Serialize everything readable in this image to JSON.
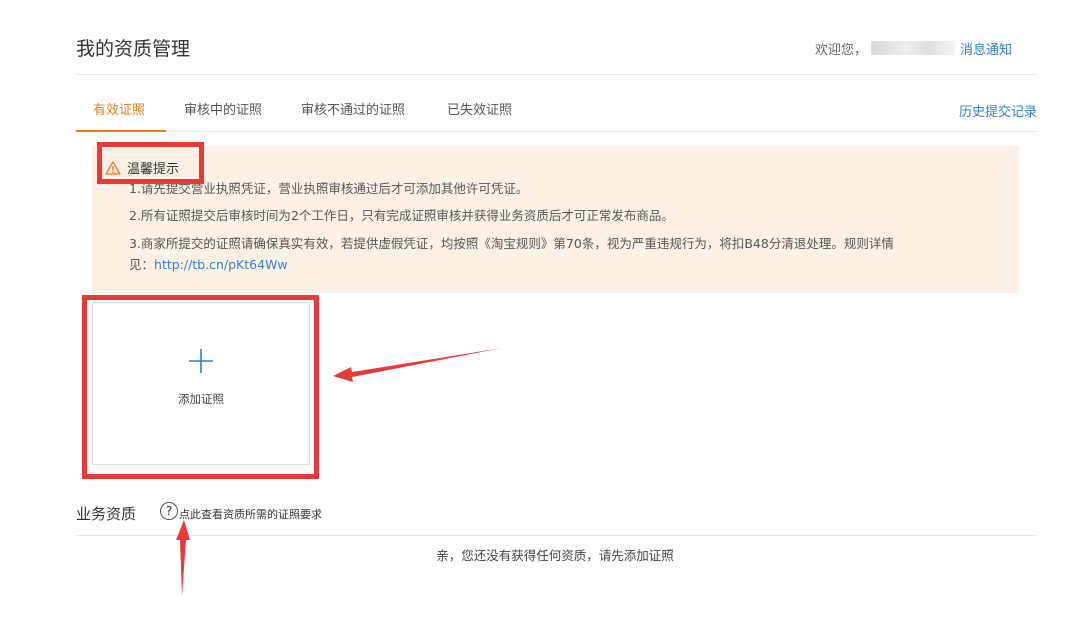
{
  "header": {
    "title": "我的资质管理",
    "welcome": "欢迎您，",
    "message_link": "消息通知"
  },
  "tabs": [
    {
      "label": "有效证照",
      "active": true
    },
    {
      "label": "审核中的证照",
      "active": false
    },
    {
      "label": "审核不通过的证照",
      "active": false
    },
    {
      "label": "已失效证照",
      "active": false
    }
  ],
  "history_link": "历史提交记录",
  "notice": {
    "title": "温馨提示",
    "lines": [
      "1.请先提交营业执照凭证，营业执照审核通过后才可添加其他许可凭证。",
      "2.所有证照提交后审核时间为2个工作日，只有完成证照审核并获得业务资质后才可正常发布商品。",
      "3.商家所提交的证照请确保真实有效，若提供虚假凭证，均按照《淘宝规则》第70条，视为严重违规行为，将扣B48分清退处理。规则详情"
    ],
    "line3_cont_prefix": "见：",
    "rules_link": "http://tb.cn/pKt64Ww"
  },
  "add_card": {
    "label": "添加证照"
  },
  "business": {
    "title": "业务资质",
    "help_text": "点此查看资质所需的证照要求",
    "empty_message": "亲，您还没有获得任何资质，请先添加证照"
  },
  "colors": {
    "accent_orange": "#ef7a1a",
    "link_blue": "#2f7fcf",
    "notice_bg": "#fdf1e6",
    "annotation_red": "#e93a3a"
  }
}
